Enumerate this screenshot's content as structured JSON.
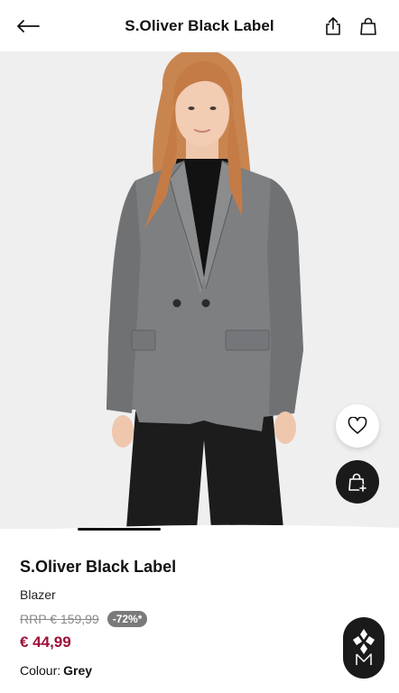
{
  "header": {
    "title": "S.Oliver Black Label",
    "back_icon": "arrow-left-icon",
    "share_icon": "share-icon",
    "cart_icon": "shopping-bag-icon"
  },
  "gallery": {
    "image_description": "product-photo",
    "slide_count": 1,
    "active_slide": 1
  },
  "actions": {
    "favorite_icon": "heart-icon",
    "add_to_bag_icon": "bag-plus-icon"
  },
  "product": {
    "brand": "S.Oliver Black Label",
    "type": "Blazer",
    "rrp": "RRP € 159,99",
    "discount": "-72%*",
    "price": "€ 44,99",
    "colour_label": "Colour:",
    "colour_value": "Grey"
  },
  "colors": {
    "sale_price": "#9b1238",
    "discount_badge": "#7a7a7a",
    "fab": "#1a1a1a"
  }
}
